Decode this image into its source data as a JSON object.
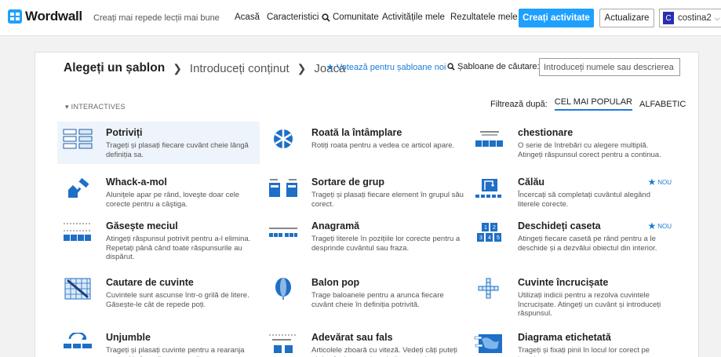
{
  "header": {
    "logo_text": "Wordwall",
    "tagline": "Creați mai repede lecții mai bune",
    "nav": [
      "Acasă",
      "Caracteristici",
      "Comunitate",
      "Activitățile mele",
      "Rezultatele mele"
    ],
    "create_label": "Creați activitate",
    "upgrade_label": "Actualizare",
    "user_initial": "C",
    "user_name": "costina2",
    "accent": "#1ea0ff"
  },
  "crumbs": {
    "step1": "Alegeți un șablon",
    "step2": "Introduceți conținut",
    "step3": "Joaca"
  },
  "vote_label": "Votează pentru șabloane noi",
  "search": {
    "label": "Șabloane de căutare:",
    "placeholder": "Introduceți numele sau descrierea ..."
  },
  "section": {
    "label": "INTERACTIVES"
  },
  "filter": {
    "label": "Filtrează după:",
    "options": [
      "CEL MAI POPULAR",
      "ALFABETIC"
    ],
    "selected": "CEL MAI POPULAR"
  },
  "templates": [
    {
      "title": "Potriviți",
      "desc": "Trageți și plasați fiecare cuvânt cheie lângă definiția sa.",
      "icon": "match-up-icon"
    },
    {
      "title": "Roată la întâmplare",
      "desc": "Rotiți roata pentru a vedea ce articol apare.",
      "icon": "wheel-icon"
    },
    {
      "title": "chestionare",
      "desc": "O serie de întrebări cu alegere multiplă. Atingeți răspunsul corect pentru a continua.",
      "icon": "quiz-icon"
    },
    {
      "title": "Whack-a-mol",
      "desc": "Aluniţele apar pe rând, loveşte doar cele corecte pentru a câştiga.",
      "icon": "whack-icon"
    },
    {
      "title": "Sortare de grup",
      "desc": "Trageți și plasați fiecare element în grupul său corect.",
      "icon": "group-sort-icon"
    },
    {
      "title": "Călău",
      "desc": "Încercați să completați cuvântul alegând literele corecte.",
      "icon": "hangman-icon",
      "badge": "NOU"
    },
    {
      "title": "Găsește meciul",
      "desc": "Atingeți răspunsul potrivit pentru a-l elimina. Repetați până când toate răspunsurile au dispărut.",
      "icon": "find-match-icon"
    },
    {
      "title": "Anagramă",
      "desc": "Trageți literele în pozițiile lor corecte pentru a desprinde cuvântul sau fraza.",
      "icon": "anagram-icon"
    },
    {
      "title": "Deschideți caseta",
      "desc": "Atingeți fiecare casetă pe rând pentru a le deschide și a dezvălui obiectul din interior.",
      "icon": "open-box-icon",
      "badge": "NOU"
    },
    {
      "title": "Cautare de cuvinte",
      "desc": "Cuvintele sunt ascunse într-o grilă de litere. Găsește-le cât de repede poți.",
      "icon": "wordsearch-icon"
    },
    {
      "title": "Balon pop",
      "desc": "Trage baloanele pentru a arunca fiecare cuvânt cheie în definiția potrivită.",
      "icon": "balloon-icon"
    },
    {
      "title": "Cuvinte încrucișate",
      "desc": "Utilizați indicii pentru a rezolva cuvintele încrucișate. Atingeți un cuvânt și introduceți răspunsul.",
      "icon": "crossword-icon"
    },
    {
      "title": "Unjumble",
      "desc": "Trageți și plasați cuvinte pentru a rearanja propoziția în ordinea corectă.",
      "icon": "unjumble-icon"
    },
    {
      "title": "Adevărat sau fals",
      "desc": "Articolele zboară cu viteză. Vedeți câți puteți obține înainte ca timpul să se termine.",
      "icon": "true-false-icon"
    },
    {
      "title": "Diagrama etichetată",
      "desc": "Trageți și fixați pinii în locul lor corect pe imagine.",
      "icon": "labelled-diagram-icon"
    }
  ]
}
